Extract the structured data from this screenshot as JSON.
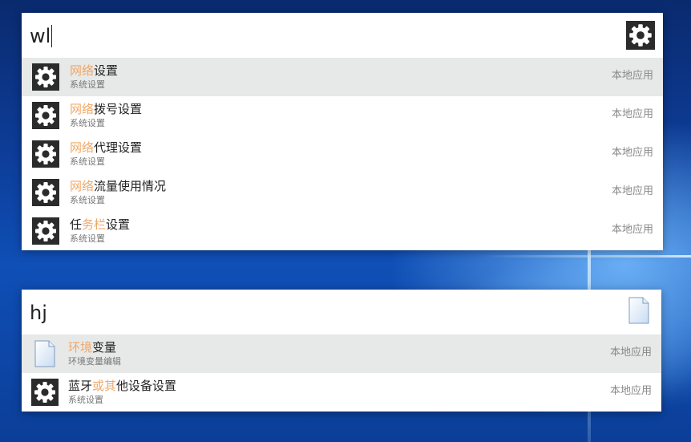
{
  "launcher_top": {
    "query": "wl",
    "results": [
      {
        "hl": "网络",
        "rest": "设置",
        "subtitle": "系统设置",
        "tag": "本地应用",
        "icon": "gear-icon"
      },
      {
        "hl": "网络",
        "rest": "拨号设置",
        "subtitle": "系统设置",
        "tag": "本地应用",
        "icon": "gear-icon"
      },
      {
        "hl": "网络",
        "rest": "代理设置",
        "subtitle": "系统设置",
        "tag": "本地应用",
        "icon": "gear-icon"
      },
      {
        "hl": "网络",
        "rest": "流量使用情况",
        "subtitle": "系统设置",
        "tag": "本地应用",
        "icon": "gear-icon"
      },
      {
        "pre": "任",
        "hl": "务栏",
        "rest": "设置",
        "subtitle": "系统设置",
        "tag": "本地应用",
        "icon": "gear-icon"
      }
    ]
  },
  "launcher_bottom": {
    "query": "hj",
    "results": [
      {
        "hl": "环境",
        "rest": "变量",
        "subtitle": "环境变量编辑",
        "tag": "本地应用",
        "icon": "document-icon"
      },
      {
        "pre": "蓝牙",
        "hl": "或其",
        "rest": "他设备设置",
        "subtitle": "系统设置",
        "tag": "本地应用",
        "icon": "gear-icon"
      }
    ]
  },
  "colors": {
    "highlight": "#f0a868",
    "selected_row": "#e7e8e8",
    "icon_bg": "#2b2b2b"
  }
}
